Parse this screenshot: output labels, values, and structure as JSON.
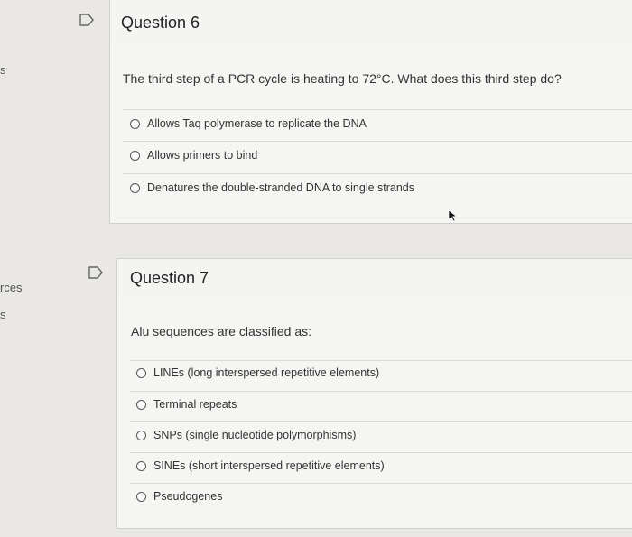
{
  "edge": {
    "fragment_top": "s",
    "fragment_mid": "rces",
    "fragment_low": "s"
  },
  "q6": {
    "title": "Question 6",
    "text": "The third step of a PCR cycle is heating to 72°C. What does this third step do?",
    "options": [
      "Allows Taq polymerase to replicate the DNA",
      "Allows primers to bind",
      "Denatures the double-stranded DNA to single strands"
    ]
  },
  "q7": {
    "title": "Question 7",
    "text": "Alu sequences are classified as:",
    "options": [
      "LINEs (long interspersed repetitive elements)",
      "Terminal repeats",
      "SNPs (single nucleotide polymorphisms)",
      "SINEs (short interspersed repetitive elements)",
      "Pseudogenes"
    ]
  },
  "icons": {
    "flag": "flag-outline-icon",
    "cursor": "mouse-pointer-icon"
  }
}
